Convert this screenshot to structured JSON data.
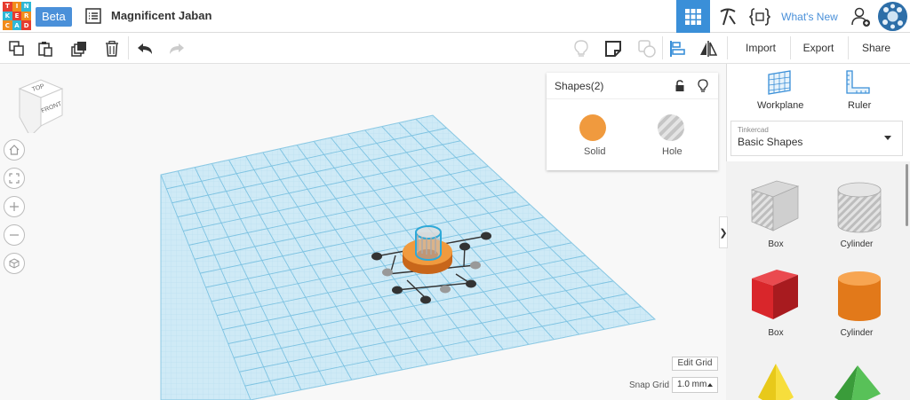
{
  "logo": {
    "letters": [
      "T",
      "I",
      "N",
      "K",
      "E",
      "R",
      "C",
      "A",
      "D"
    ],
    "colors": [
      "#e63c2f",
      "#f28c1b",
      "#2eb8d6",
      "#2eb8d6",
      "#e63c2f",
      "#f28c1b",
      "#f28c1b",
      "#2eb8d6",
      "#e63c2f"
    ]
  },
  "header": {
    "beta_label": "Beta",
    "title": "Magnificent Jaban",
    "whats_new": "What's New"
  },
  "toolbar": {
    "import": "Import",
    "export": "Export",
    "share": "Share"
  },
  "viewcube": {
    "top": "TOP",
    "front": "FRONT"
  },
  "shapes_panel": {
    "title": "Shapes(2)",
    "solid": "Solid",
    "hole": "Hole",
    "solid_color": "#f09a3e"
  },
  "grid_controls": {
    "edit_grid": "Edit Grid",
    "snap_grid_label": "Snap Grid",
    "snap_grid_value": "1.0 mm"
  },
  "sidebar": {
    "workplane": "Workplane",
    "ruler": "Ruler",
    "library_small": "Tinkercad",
    "library_value": "Basic Shapes",
    "shapes": [
      {
        "label": "Box"
      },
      {
        "label": "Cylinder"
      },
      {
        "label": "Box"
      },
      {
        "label": "Cylinder"
      }
    ]
  },
  "colors": {
    "accent": "#3a8fd8",
    "grid": "#a8d8ec",
    "orange": "#f09a3e",
    "red": "#d9262b"
  }
}
